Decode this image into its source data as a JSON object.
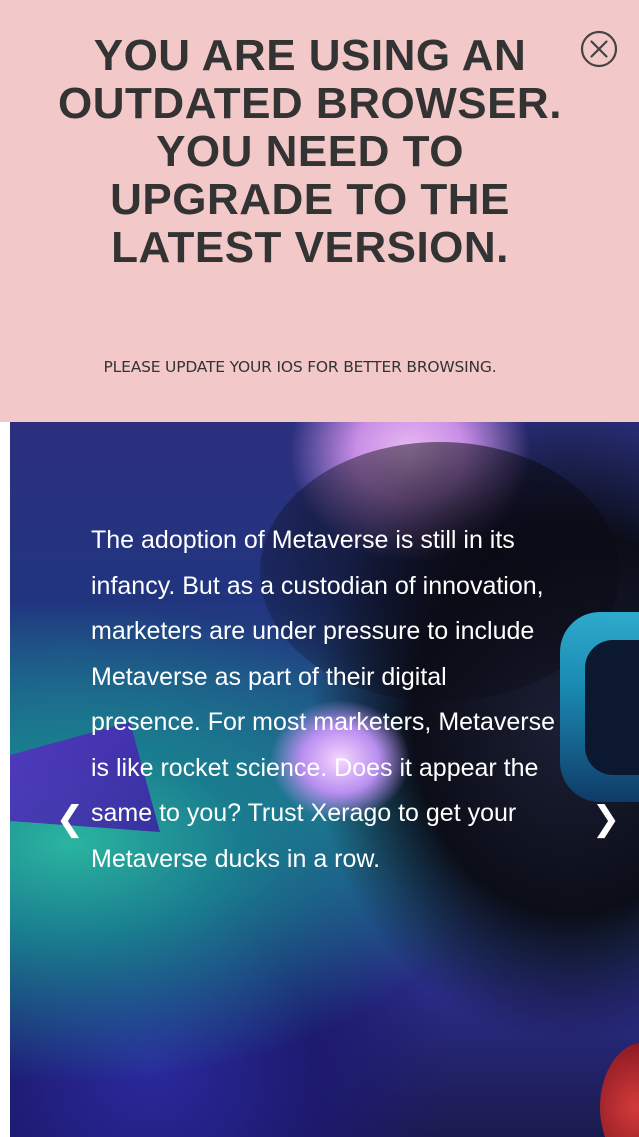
{
  "banner": {
    "title": "YOU ARE USING AN OUTDATED BROWSER. YOU NEED TO UPGRADE TO THE LATEST VERSION.",
    "subtitle": "PLEASE UPDATE YOUR IOS FOR BETTER BROWSING.",
    "close_icon": "close-circle-icon",
    "background_color": "#f2c9c8",
    "text_color": "#333333"
  },
  "slide": {
    "text": "The adoption of Metaverse is still in its infancy. But as a custodian of innovation, marketers are under pressure to include Metaverse as part of their digital presence. For most marketers, Metaverse is like rocket science. Does it appear the same to you? Trust Xerago to get your Metaverse ducks in a row.",
    "prev_icon": "chevron-left-icon",
    "next_icon": "chevron-right-icon",
    "prev_glyph": "❮",
    "next_glyph": "❯"
  }
}
